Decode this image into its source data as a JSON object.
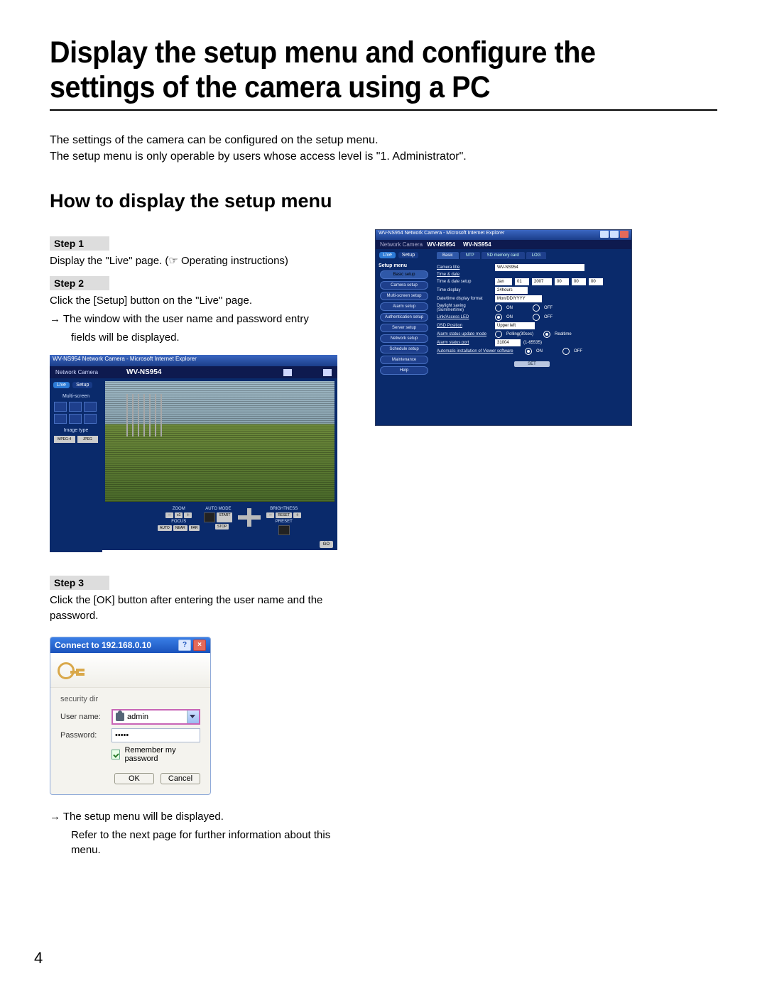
{
  "page_number": "4",
  "title": "Display the setup menu and configure the settings of the camera using a PC",
  "intro": {
    "line1": "The settings of the camera can be configured on the setup menu.",
    "line2": "The setup menu is only operable by users whose access level is \"1. Administrator\"."
  },
  "section_heading": "How to display the setup menu",
  "steps": {
    "s1_label": "Step 1",
    "s1_text": "Display the \"Live\" page. (☞ Operating instructions)",
    "s2_label": "Step 2",
    "s2_text": "Click the [Setup] button on the \"Live\" page.",
    "s2_arrow": "→ The window with the user name and password entry",
    "s2_arrow2": "fields will be displayed.",
    "s3_label": "Step 3",
    "s3_text": "Click the [OK] button after entering the user name and the password.",
    "s3_arrow": "→ The setup menu will be displayed.",
    "s3_arrow2": "Refer to the next page for further information about this menu."
  },
  "live_shot": {
    "titlebar": "WV-NS954 Network Camera - Microsoft Internet Explorer",
    "brand_label": "Network Camera",
    "model": "WV-NS954",
    "tab_live": "Live",
    "tab_setup": "Setup",
    "multi_screen": "Multi-screen",
    "image_type": "Image type",
    "type_mpeg4": "MPEG-4",
    "type_jpeg": "JPEG",
    "zoom": "ZOOM",
    "focus": "FOCUS",
    "auto_mode": "AUTO MODE",
    "brightness": "BRIGHTNESS",
    "start": "START",
    "stop": "STOP",
    "auto": "AUTO",
    "near": "NEAR",
    "far": "FAR",
    "reset": "RESET",
    "preset": "PRESET",
    "x1": "x1",
    "go": "GO"
  },
  "login": {
    "title": "Connect to 192.168.0.10",
    "realm": "security dir",
    "user_label": "User name:",
    "pass_label": "Password:",
    "user_value": "admin",
    "pass_value": "•••••",
    "remember": "Remember my password",
    "ok": "OK",
    "cancel": "Cancel"
  },
  "setup_shot": {
    "titlebar": "WV-NS954 Network Camera - Microsoft Internet Explorer",
    "brand_label": "Network Camera",
    "brand_sub": "WV-NS954",
    "model": "WV-NS954",
    "tab_live": "Live",
    "tab_setup": "Setup",
    "setup_menu_label": "Setup menu",
    "nav": [
      "Basic setup",
      "Camera setup",
      "Multi-screen setup",
      "Alarm setup",
      "Authentication setup",
      "Server setup",
      "Network setup",
      "Schedule setup",
      "Maintenance",
      "Help"
    ],
    "tabs": [
      "Basic",
      "NTP",
      "SD memory card",
      "LOG"
    ],
    "rows": {
      "camera_title": "Camera title",
      "camera_title_val": "WV-NS954",
      "time_date": "Time & date",
      "time_date_setup": "Time & date setup",
      "time_date_val_parts": [
        "Jan",
        "01",
        "2007",
        "00",
        "00",
        "00"
      ],
      "time_display": "Time display",
      "time_display_val": "24hours",
      "date_format": "Date/time display format",
      "date_format_val": "Mon/DD/YYYY",
      "dst": "Daylight saving (Summertime)",
      "on": "ON",
      "off": "OFF",
      "link_led": "Link/Access LED",
      "osd_pos": "OSD Position",
      "osd_pos_val": "Upper left",
      "alarm_mode": "Alarm status update mode",
      "alarm_mode_a": "Polling(30sec)",
      "alarm_mode_b": "Realtime",
      "alarm_port": "Alarm status port",
      "alarm_port_val": "31004",
      "alarm_port_hint": "(1-65535)",
      "auto_install": "Automatic installation of Viewer software",
      "set": "SET"
    }
  }
}
